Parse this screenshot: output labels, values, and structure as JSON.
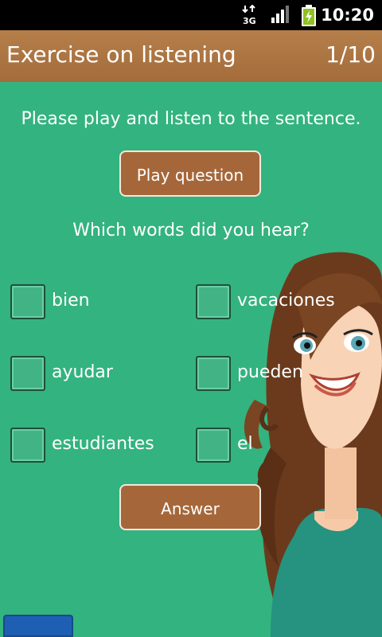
{
  "status_bar": {
    "time": "10:20",
    "network": "3G",
    "icons": [
      "3g-icon",
      "signal-icon",
      "battery-icon"
    ]
  },
  "header": {
    "title": "Exercise on listening",
    "counter": "1/10"
  },
  "main": {
    "instruction": "Please play and listen to the sentence.",
    "play_button": "Play question",
    "question": "Which words did you hear?",
    "options": [
      {
        "label": "bien",
        "checked": false
      },
      {
        "label": "vacaciones",
        "checked": false
      },
      {
        "label": "ayudar",
        "checked": false
      },
      {
        "label": "pueden",
        "checked": false
      },
      {
        "label": "estudiantes",
        "checked": false
      },
      {
        "label": "el",
        "checked": false
      }
    ],
    "answer_button": "Answer"
  },
  "colors": {
    "background": "#33b37f",
    "header": "#a36c3a",
    "button": "#a5673a"
  }
}
